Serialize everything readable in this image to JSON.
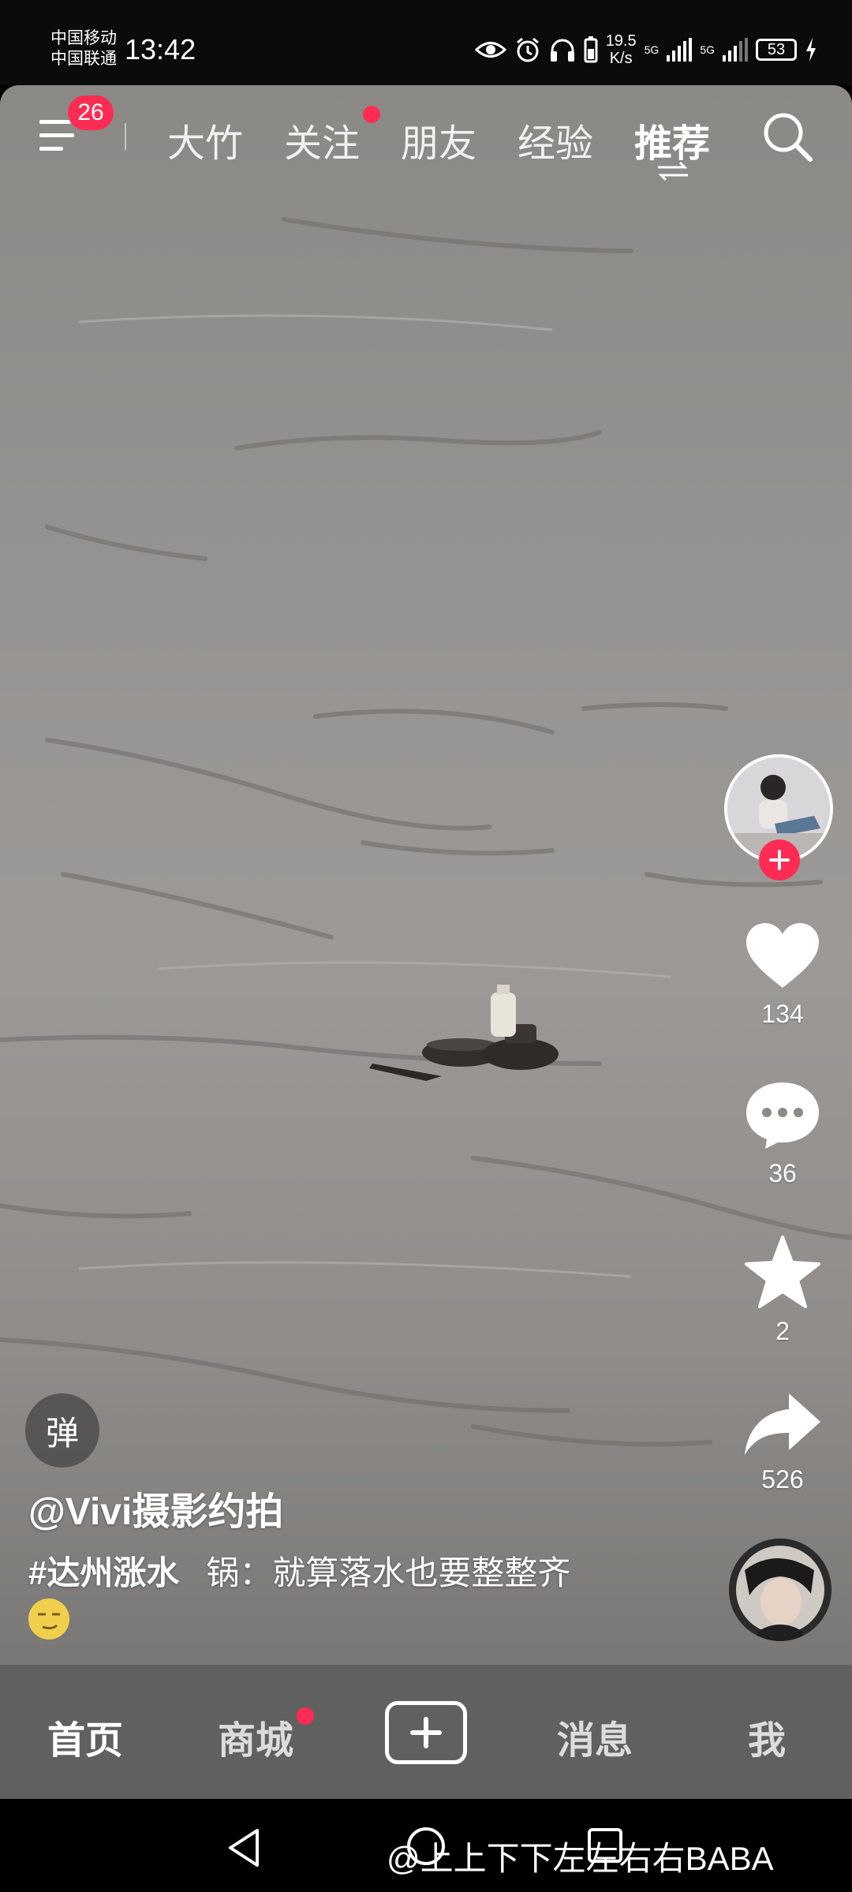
{
  "status_bar": {
    "carrier_1": "中国移动",
    "carrier_2": "中国联通",
    "time": "13:42",
    "net_speed": "19.5",
    "net_unit": "K/s",
    "sig_1": "5G",
    "sig_2": "5G",
    "battery": "53"
  },
  "top_nav": {
    "menu_badge": "26",
    "tabs": [
      {
        "label": "大竹"
      },
      {
        "label": "关注"
      },
      {
        "label": "朋友"
      },
      {
        "label": "经验"
      },
      {
        "label": "推荐"
      }
    ],
    "active_tab": "推荐"
  },
  "actions": {
    "like_count": "134",
    "comment_count": "36",
    "favorite_count": "2",
    "share_count": "526"
  },
  "video_info": {
    "danmu_label": "弹",
    "author": "@Vivi摄影约拍",
    "hashtag": "#达州涨水",
    "caption": "锅：就算落水也要整整齐"
  },
  "bottom_nav": {
    "items": [
      {
        "label": "首页"
      },
      {
        "label": "商城"
      },
      {
        "label": "消息"
      },
      {
        "label": "我"
      }
    ]
  },
  "watermark": "@上上下下左左右右BABA",
  "colors": {
    "accent": "#fe2c55",
    "nav_bg": "#606060",
    "water": "#959391"
  },
  "icons": [
    "menu-icon",
    "search-icon",
    "swap-icon",
    "heart-icon",
    "comment-icon",
    "star-icon",
    "share-icon",
    "plus-icon",
    "back-icon",
    "home-icon",
    "recents-icon"
  ]
}
